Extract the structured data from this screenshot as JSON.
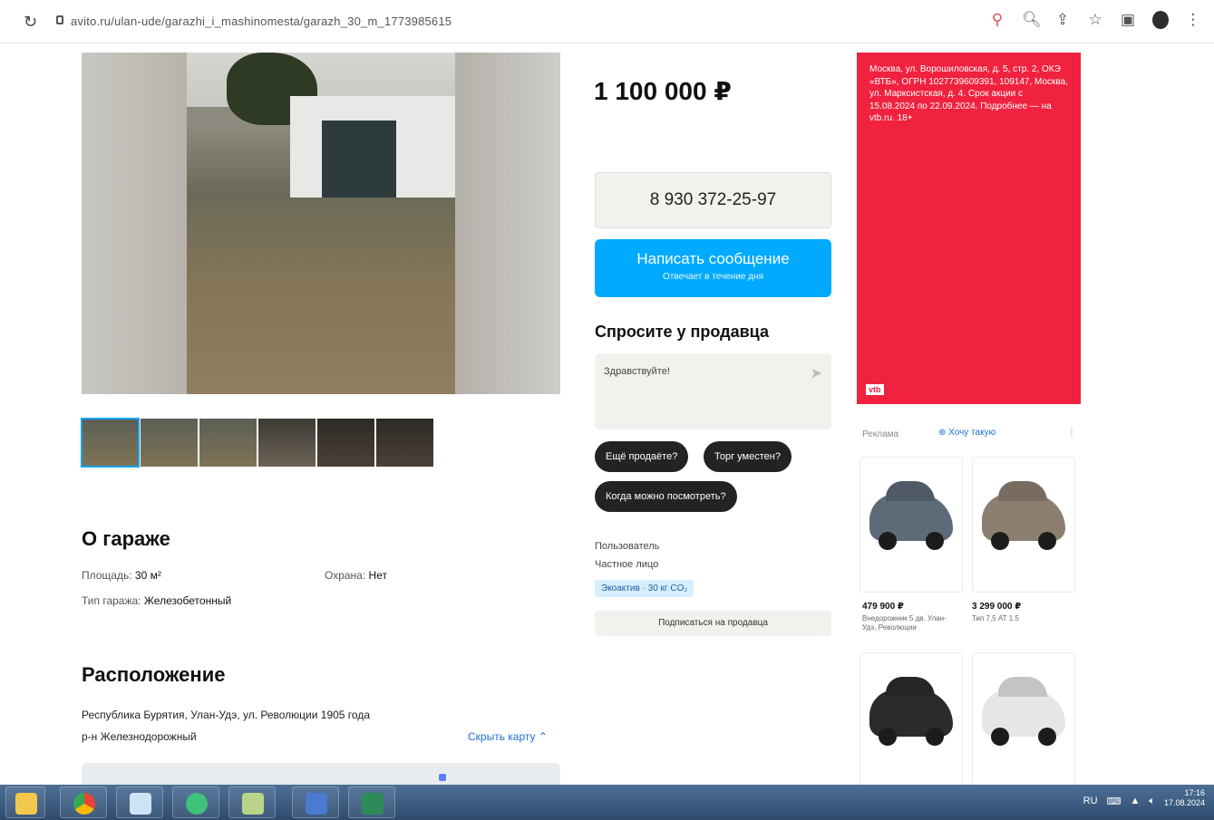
{
  "browser": {
    "url": "avito.ru/ulan-ude/garazhi_i_mashinomesta/garazh_30_m_1773985615",
    "reload_icon": "↻"
  },
  "listing": {
    "price": "1 100 000 ₽",
    "phone": "8 930 372-25-97",
    "message_btn": "Написать сообщение",
    "message_btn_sub": "Отвечает в течение дня",
    "ask_title": "Спросите у продавца",
    "ask_placeholder": "Здравствуйте!",
    "chips": [
      "Ещё продаёте?",
      "Торг уместен?",
      "Когда можно посмотреть?"
    ],
    "seller_label": "Пользователь",
    "seller_type": "Частное лицо",
    "seller_badge": "Экоактив · 30 кг CO₂",
    "subscribe_btn": "Подписаться на продавца"
  },
  "about": {
    "title": "О гараже",
    "area_label": "Площадь:",
    "area_value": "30 м²",
    "security_label": "Охрана:",
    "security_value": "Нет",
    "type_label": "Тип гаража:",
    "type_value": "Железобетонный"
  },
  "location": {
    "title": "Расположение",
    "address": "Республика Бурятия, Улан-Удэ, ул. Революции 1905 года",
    "district": "р-н Железнодорожный",
    "hide_map": "Скрыть карту"
  },
  "ad": {
    "red_text": "Москва, ул. Ворошиловская, д. 5, стр. 2, ОКЭ «ВТБ», ОГРН 1027739609391, 109147, Москва, ул. Марксистская, д. 4. Срок акции с 15.08.2024 по 22.09.2024. Подробнее — на vtb.ru. 18+",
    "red_logo": "vtb",
    "box_label": "Реклама",
    "box_link": "Хочу такую",
    "cars": [
      {
        "price": "479 900 ₽",
        "desc": "Внедорожник 5 дв. Улан-Удэ, Революции"
      },
      {
        "price": "3 299 000 ₽",
        "desc": "Тип 7,5 АТ 1.5"
      }
    ]
  },
  "taskbar": {
    "lang": "RU",
    "time": "17:16",
    "date": "17.08.2024"
  }
}
